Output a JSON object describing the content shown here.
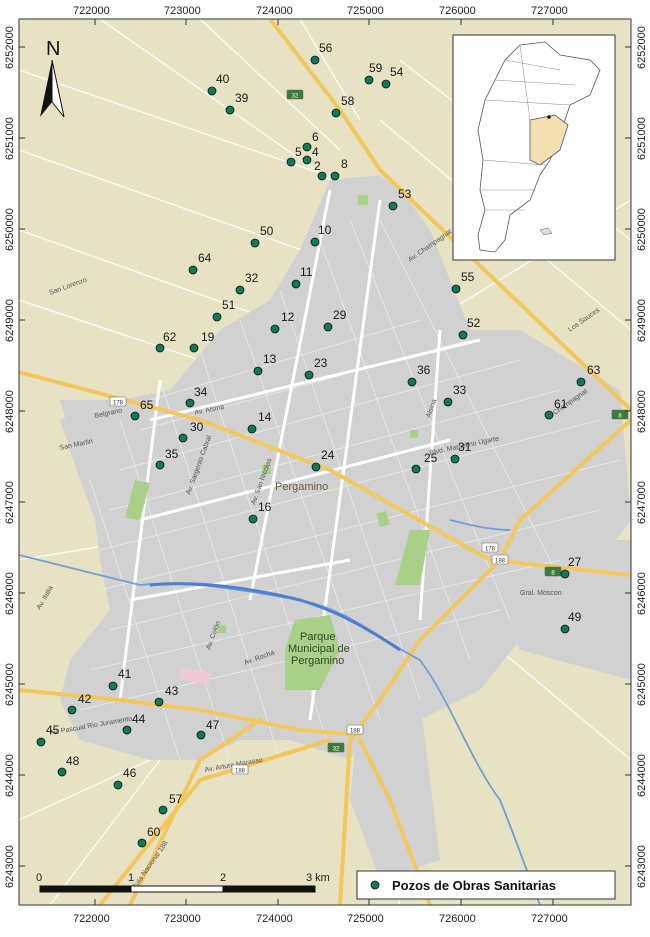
{
  "axes": {
    "x_ticks": [
      "722000",
      "723000",
      "724000",
      "725000",
      "726000",
      "727000"
    ],
    "y_ticks": [
      "6252000",
      "6251000",
      "6250000",
      "6249000",
      "6248000",
      "6247000",
      "6246000",
      "6245000",
      "6244000",
      "6243000"
    ]
  },
  "north_label": "N",
  "place_labels": {
    "city": "Pergamino",
    "park_line1": "Parque",
    "park_line2": "Municipal de",
    "park_line3": "Pergamino"
  },
  "road_shields": [
    "178",
    "178",
    "188",
    "188",
    "188",
    "32",
    "32",
    "8",
    "8"
  ],
  "street_labels": [
    "Av. Champagnat",
    "Champagnat",
    "Blvd. Marcelino Ugarte",
    "Av. Pascual Rio Juramento",
    "Ruta Nacional 188",
    "Av. Sargento Cabral",
    "Av. Colón",
    "San Lorenzo",
    "Los Sauces",
    "Belgrano",
    "San Martin",
    "Av. Arturo Marasso",
    "Av. Italia",
    "Gral. Moscon",
    "Av. Alsina",
    "Av. San Nicolas",
    "Alsina",
    "Av. Rocha"
  ],
  "scale_bar": {
    "labels": [
      "0",
      "1",
      "2",
      "3 km"
    ]
  },
  "legend": {
    "label": "Pozos de Obras Sanitarias"
  },
  "wells": [
    "2",
    "4",
    "5",
    "6",
    "8",
    "10",
    "11",
    "12",
    "13",
    "14",
    "16",
    "19",
    "23",
    "24",
    "25",
    "27",
    "29",
    "30",
    "31",
    "32",
    "33",
    "34",
    "35",
    "36",
    "39",
    "40",
    "41",
    "42",
    "43",
    "44",
    "45",
    "46",
    "47",
    "48",
    "49",
    "50",
    "51",
    "52",
    "53",
    "54",
    "55",
    "56",
    "57",
    "58",
    "59",
    "60",
    "61",
    "62",
    "63",
    "64",
    "65"
  ],
  "colors": {
    "map_bg": "#e8e2c5",
    "urban": "#d1d1d1",
    "road_major": "#f2c75c",
    "well_fill": "#0f7a5a",
    "inset_province": "#f5deb0"
  }
}
